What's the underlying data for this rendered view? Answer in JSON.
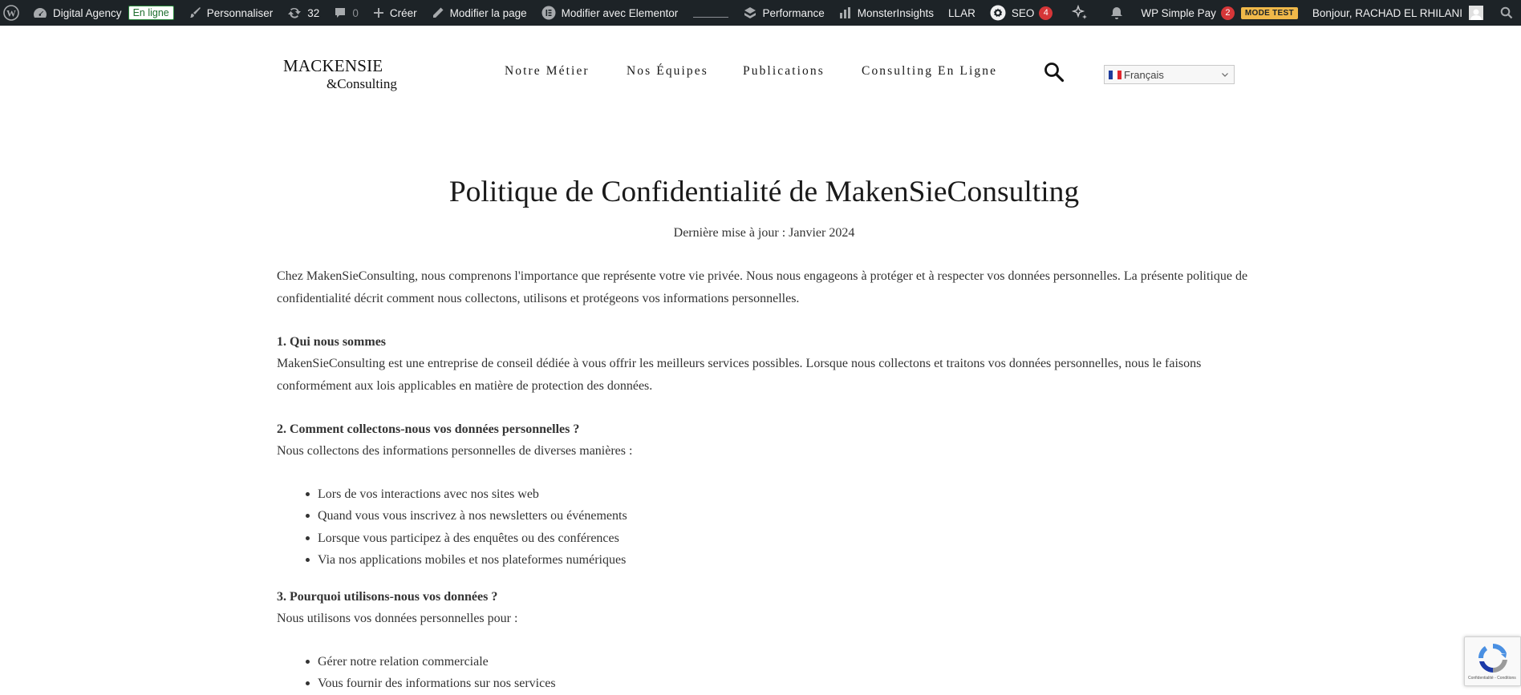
{
  "admin_bar": {
    "site_name": "Digital Agency",
    "online_badge": "En ligne",
    "customize": "Personnaliser",
    "updates_count": "32",
    "comments_count": "0",
    "create": "Créer",
    "edit_page": "Modifier la page",
    "edit_elementor": "Modifier avec Elementor",
    "performance": "Performance",
    "monsterinsights": "MonsterInsights",
    "llar": "LLAR",
    "seo": "SEO",
    "seo_count": "4",
    "simple_pay": "WP Simple Pay",
    "simple_pay_count": "2",
    "mode_test": "MODE TEST",
    "greeting": "Bonjour, RACHAD EL RHILANI"
  },
  "header": {
    "logo_line1": "MACKENSIE",
    "logo_line2": "&Consulting",
    "nav": [
      "Notre Métier",
      "Nos Équipes",
      "Publications",
      "Consulting En Ligne"
    ],
    "language": "Français"
  },
  "content": {
    "title": "Politique de Confidentialité de MakenSieConsulting",
    "updated": "Dernière mise à jour : Janvier 2024",
    "intro": "Chez MakenSieConsulting, nous comprenons l'importance que représente votre vie privée. Nous nous engageons à protéger et à respecter vos données personnelles. La présente politique de confidentialité décrit comment nous collectons, utilisons et protégeons vos informations personnelles.",
    "s1_heading": "1. Qui nous sommes",
    "s1_text": "MakenSieConsulting est une entreprise de conseil dédiée à vous offrir les meilleurs services possibles. Lorsque nous collectons et traitons vos données personnelles, nous le faisons conformément aux lois applicables en matière de protection des données.",
    "s2_heading": "2. Comment collectons-nous vos données personnelles ?",
    "s2_text": "Nous collectons des informations personnelles de diverses manières :",
    "s2_items": [
      "Lors de vos interactions avec nos sites web",
      "Quand vous vous inscrivez à nos newsletters ou événements",
      "Lorsque vous participez à des enquêtes ou des conférences",
      "Via nos applications mobiles et nos plateformes numériques"
    ],
    "s3_heading": "3. Pourquoi utilisons-nous vos données ?",
    "s3_text": "Nous utilisons vos données personnelles pour :",
    "s3_items": [
      "Gérer notre relation commerciale",
      "Vous fournir des informations sur nos services"
    ]
  },
  "recaptcha": {
    "text": "Confidentialité - Conditions"
  }
}
